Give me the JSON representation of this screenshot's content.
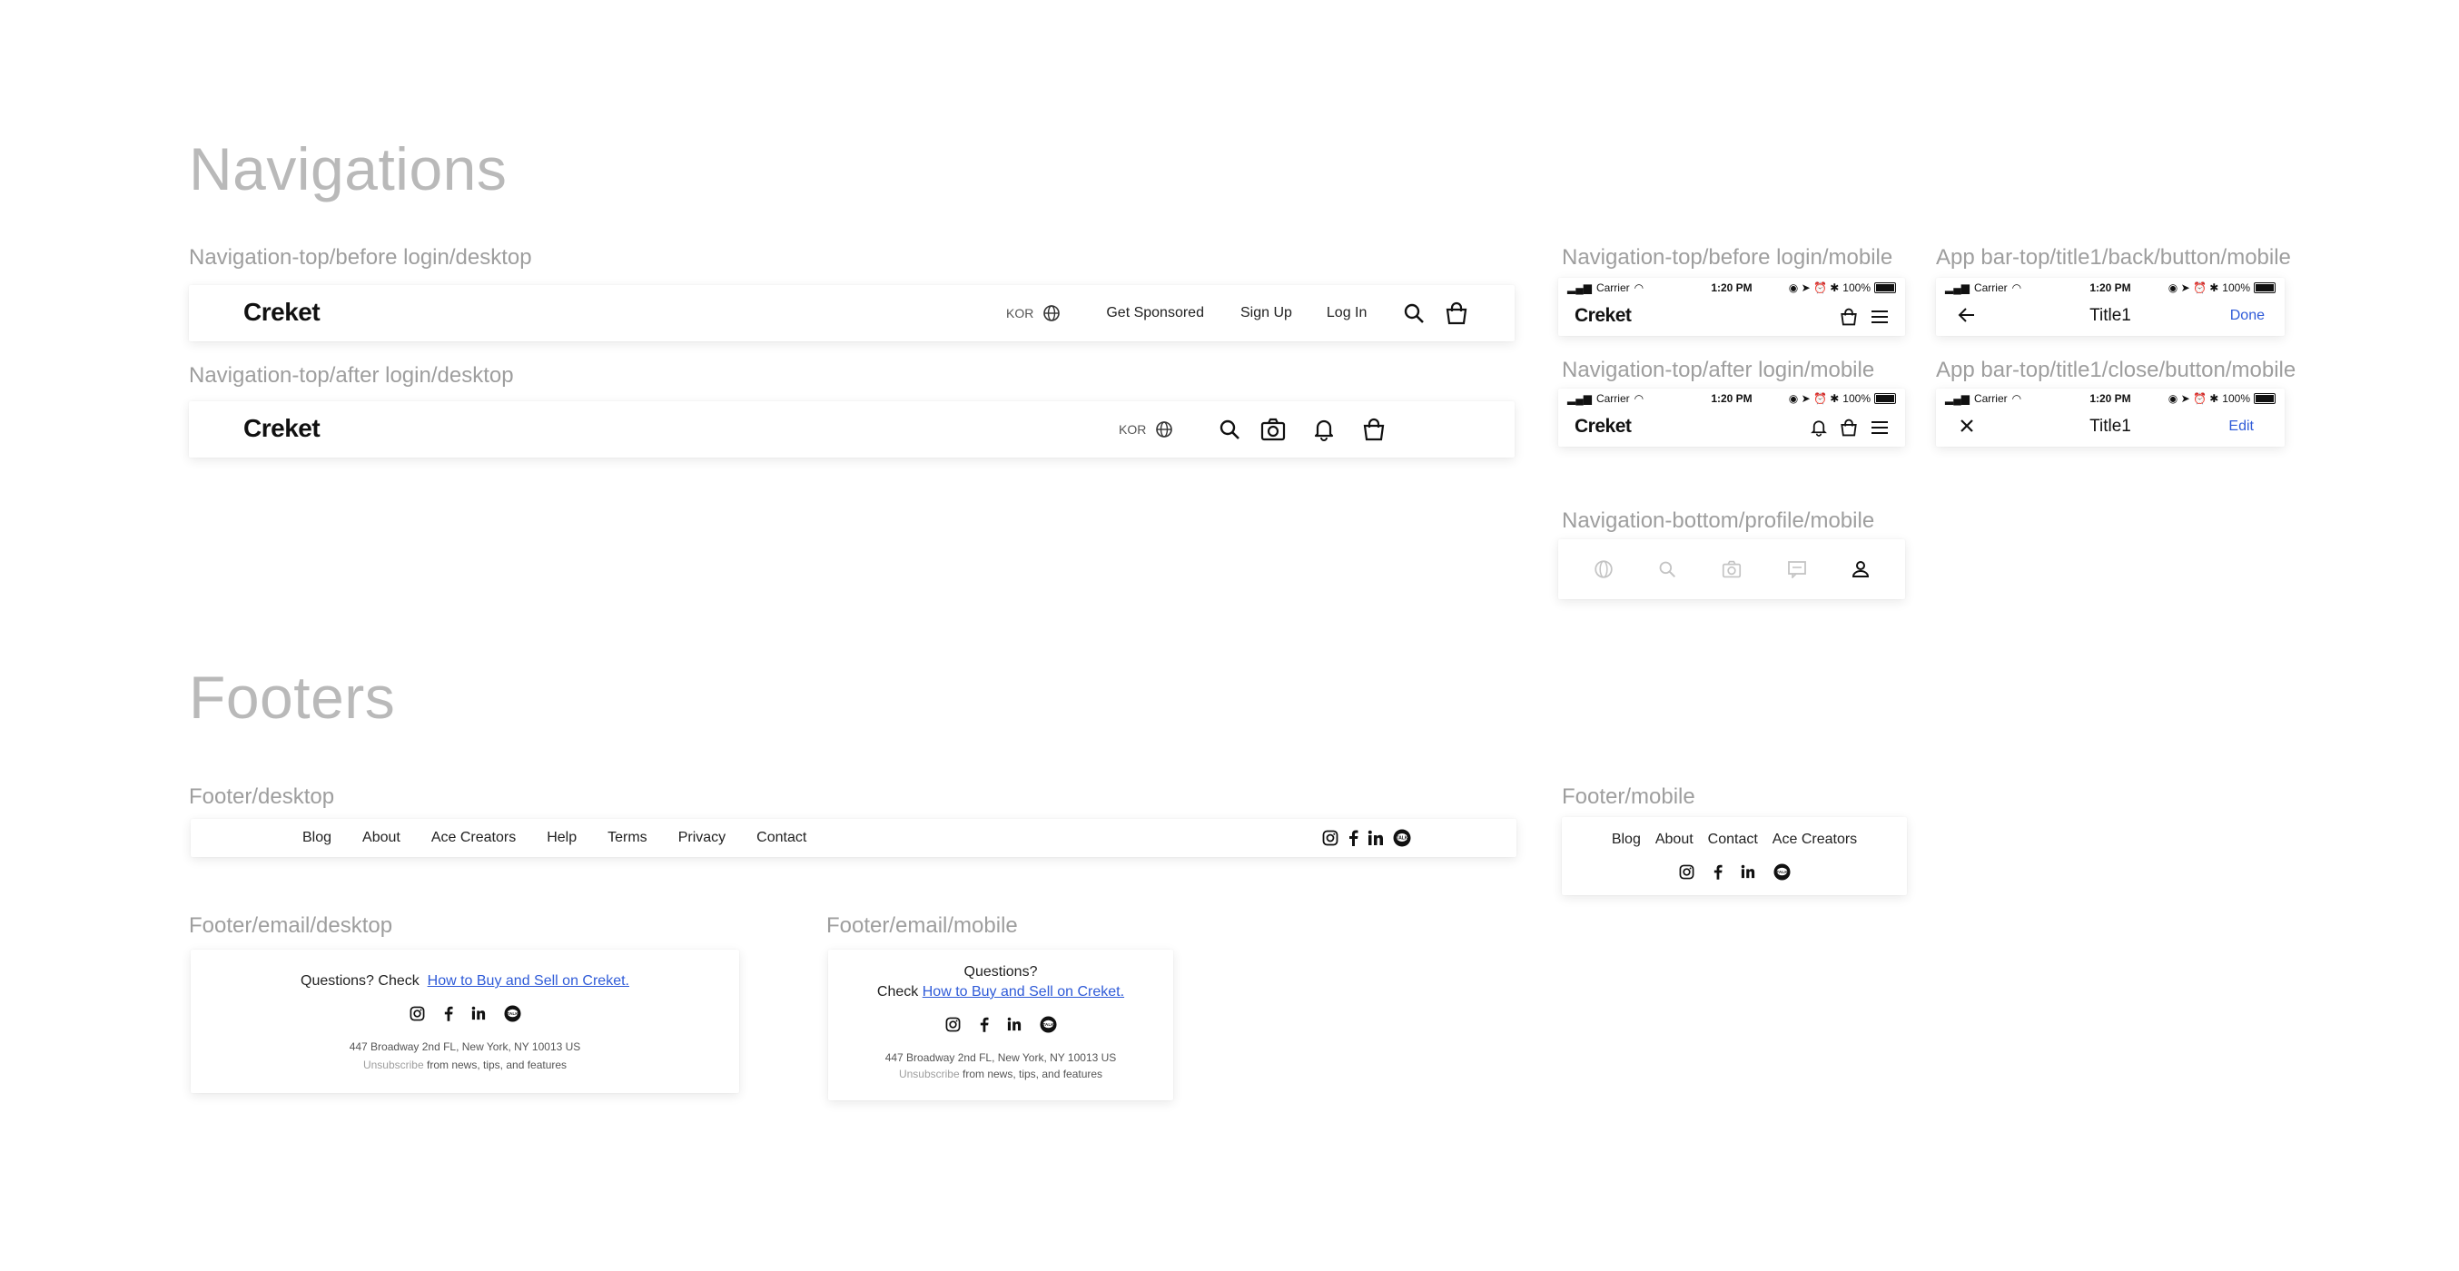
{
  "sections": {
    "navigations": "Navigations",
    "footers": "Footers"
  },
  "labels": {
    "nav_before_desktop": "Navigation-top/before login/desktop",
    "nav_after_desktop": "Navigation-top/after login/desktop",
    "nav_before_mobile": "Navigation-top/before login/mobile",
    "nav_after_mobile": "Navigation-top/after login/mobile",
    "appbar_back": "App bar-top/title1/back/button/mobile",
    "appbar_close": "App bar-top/title1/close/button/mobile",
    "nav_bottom": "Navigation-bottom/profile/mobile",
    "footer_desktop": "Footer/desktop",
    "footer_mobile": "Footer/mobile",
    "footer_email_desktop": "Footer/email/desktop",
    "footer_email_mobile": "Footer/email/mobile"
  },
  "brand": {
    "logo": "Creket"
  },
  "nav_desktop": {
    "lang": "KOR",
    "get_sponsored": "Get Sponsored",
    "sign_up": "Sign Up",
    "log_in": "Log In"
  },
  "status_bar": {
    "carrier": "Carrier",
    "time": "1:20 PM",
    "battery": "100%"
  },
  "appbar": {
    "title": "Title1",
    "done": "Done",
    "edit": "Edit"
  },
  "footer_desktop_links": [
    "Blog",
    "About",
    "Ace Creators",
    "Help",
    "Terms",
    "Privacy",
    "Contact"
  ],
  "footer_mobile_links": [
    "Blog",
    "About",
    "Contact",
    "Ace Creators"
  ],
  "email": {
    "questions_check": "Questions? Check",
    "questions": "Questions?",
    "check": "Check",
    "link": "How to Buy and Sell on Creket.",
    "address": "447 Broadway 2nd FL, New York, NY 10013 US",
    "unsubscribe": "Unsubscribe",
    "unsubscribe_rest": "from news, tips, and features"
  },
  "icons": {
    "globe": "globe-icon",
    "search": "search-icon",
    "bag": "shopping-bag-icon",
    "camera": "camera-icon",
    "bell": "bell-icon",
    "menu": "hamburger-menu-icon",
    "back": "arrow-left-icon",
    "close": "close-icon",
    "chat": "chat-icon",
    "profile": "profile-icon",
    "instagram": "instagram-icon",
    "facebook": "facebook-icon",
    "linkedin": "linkedin-icon",
    "kakao": "kakaotalk-icon"
  },
  "colors": {
    "link": "#2f5bd8",
    "label": "#9e9e9e",
    "section": "#b9b9b9",
    "inactive": "#c4c4c4"
  }
}
